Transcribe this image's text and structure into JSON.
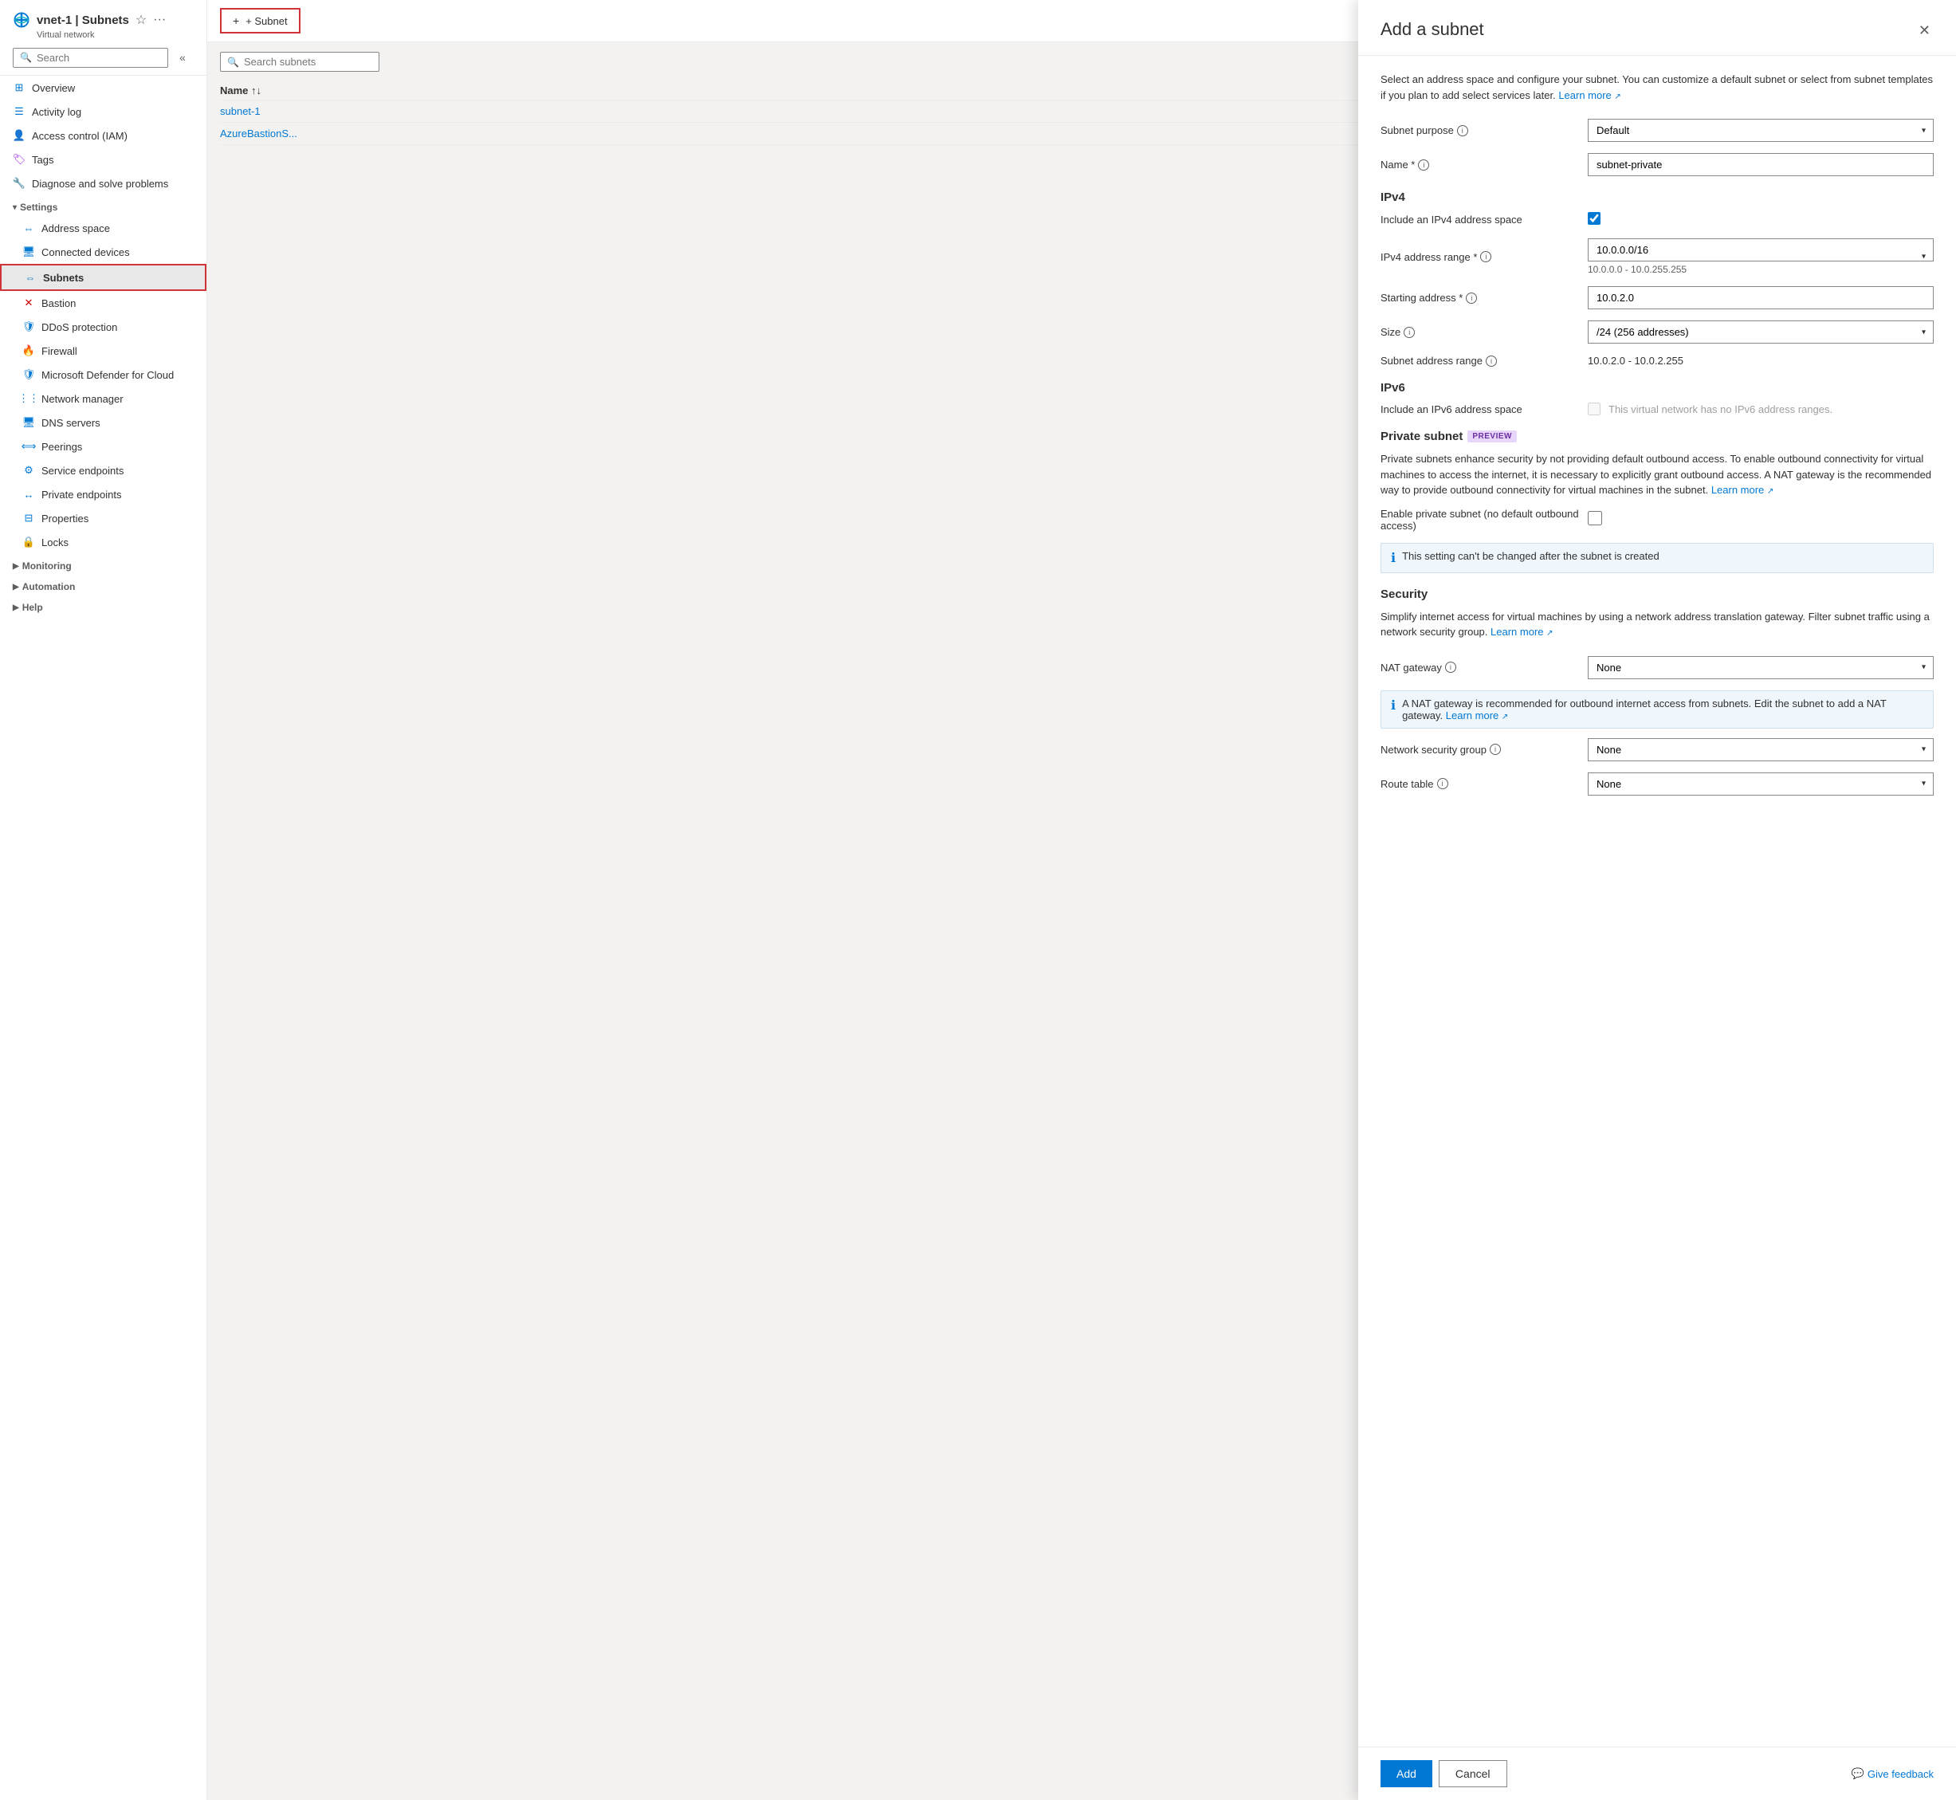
{
  "sidebar": {
    "title": "vnet-1 | Subnets",
    "subtitle": "Virtual network",
    "search_placeholder": "Search",
    "nav_items": [
      {
        "id": "overview",
        "label": "Overview",
        "icon": "overview"
      },
      {
        "id": "activity-log",
        "label": "Activity log",
        "icon": "activity"
      },
      {
        "id": "access-control",
        "label": "Access control (IAM)",
        "icon": "access"
      },
      {
        "id": "tags",
        "label": "Tags",
        "icon": "tags"
      },
      {
        "id": "diagnose",
        "label": "Diagnose and solve problems",
        "icon": "diagnose"
      },
      {
        "id": "settings-section",
        "label": "Settings",
        "icon": "settings",
        "type": "section"
      },
      {
        "id": "address-space",
        "label": "Address space",
        "icon": "address"
      },
      {
        "id": "connected-devices",
        "label": "Connected devices",
        "icon": "connected"
      },
      {
        "id": "subnets",
        "label": "Subnets",
        "icon": "subnets",
        "active": true
      },
      {
        "id": "bastion",
        "label": "Bastion",
        "icon": "bastion"
      },
      {
        "id": "ddos",
        "label": "DDoS protection",
        "icon": "ddos"
      },
      {
        "id": "firewall",
        "label": "Firewall",
        "icon": "firewall"
      },
      {
        "id": "defender",
        "label": "Microsoft Defender for Cloud",
        "icon": "defender"
      },
      {
        "id": "network-manager",
        "label": "Network manager",
        "icon": "network-manager"
      },
      {
        "id": "dns-servers",
        "label": "DNS servers",
        "icon": "dns"
      },
      {
        "id": "peerings",
        "label": "Peerings",
        "icon": "peerings"
      },
      {
        "id": "service-endpoints",
        "label": "Service endpoints",
        "icon": "service-endpoints"
      },
      {
        "id": "private-endpoints",
        "label": "Private endpoints",
        "icon": "private-endpoints"
      },
      {
        "id": "properties",
        "label": "Properties",
        "icon": "properties"
      },
      {
        "id": "locks",
        "label": "Locks",
        "icon": "locks"
      },
      {
        "id": "monitoring-section",
        "label": "Monitoring",
        "icon": "monitoring",
        "type": "section-collapsed"
      },
      {
        "id": "automation-section",
        "label": "Automation",
        "icon": "automation",
        "type": "section-collapsed"
      },
      {
        "id": "help-section",
        "label": "Help",
        "icon": "help",
        "type": "section-collapsed"
      }
    ]
  },
  "main": {
    "add_button_label": "+ Subnet",
    "search_subnets_placeholder": "Search subnets",
    "table_header": "Name ↑↓",
    "rows": [
      {
        "name": "subnet-1"
      },
      {
        "name": "AzureBastionS..."
      }
    ]
  },
  "panel": {
    "title": "Add a subnet",
    "description": "Select an address space and configure your subnet. You can customize a default subnet or select from subnet templates if you plan to add select services later.",
    "learn_more": "Learn more",
    "subnet_purpose_label": "Subnet purpose",
    "subnet_purpose_info": true,
    "subnet_purpose_value": "Default",
    "name_label": "Name *",
    "name_info": true,
    "name_value": "subnet-private",
    "ipv4_section": "IPv4",
    "include_ipv4_label": "Include an IPv4 address space",
    "include_ipv4_checked": true,
    "ipv4_range_label": "IPv4 address range *",
    "ipv4_range_info": true,
    "ipv4_range_value": "10.0.0.0/16",
    "ipv4_range_sub": "10.0.0.0 - 10.0.255.255",
    "starting_address_label": "Starting address *",
    "starting_address_info": true,
    "starting_address_value": "10.0.2.0",
    "size_label": "Size",
    "size_info": true,
    "size_value": "/24 (256 addresses)",
    "subnet_range_label": "Subnet address range",
    "subnet_range_info": true,
    "subnet_range_value": "10.0.2.0 - 10.0.2.255",
    "ipv6_section": "IPv6",
    "include_ipv6_label": "Include an IPv6 address space",
    "include_ipv6_checked": false,
    "include_ipv6_disabled_text": "This virtual network has no IPv6 address ranges.",
    "private_subnet_section": "Private subnet",
    "private_preview_badge": "PREVIEW",
    "private_desc": "Private subnets enhance security by not providing default outbound access. To enable outbound connectivity for virtual machines to access the internet, it is necessary to explicitly grant outbound access. A NAT gateway is the recommended way to provide outbound connectivity for virtual machines in the subnet.",
    "private_learn_more": "Learn more",
    "enable_private_label": "Enable private subnet (no default outbound access)",
    "enable_private_checked": false,
    "private_info_text": "This setting can't be changed after the subnet is created",
    "security_section": "Security",
    "security_desc": "Simplify internet access for virtual machines by using a network address translation gateway. Filter subnet traffic using a network security group.",
    "security_learn_more": "Learn more",
    "nat_gateway_label": "NAT gateway",
    "nat_gateway_info": true,
    "nat_gateway_value": "None",
    "nat_info_text": "A NAT gateway is recommended for outbound internet access from subnets. Edit the subnet to add a NAT gateway.",
    "nat_learn_more": "Learn more",
    "nsg_label": "Network security group",
    "nsg_info": true,
    "nsg_value": "None",
    "route_table_label": "Route table",
    "route_table_info": true,
    "route_table_value": "None",
    "add_button": "Add",
    "cancel_button": "Cancel",
    "feedback_label": "Give feedback"
  },
  "colors": {
    "primary": "#0078d4",
    "highlight": "#d13438",
    "active_bg": "#e8e8e8"
  }
}
